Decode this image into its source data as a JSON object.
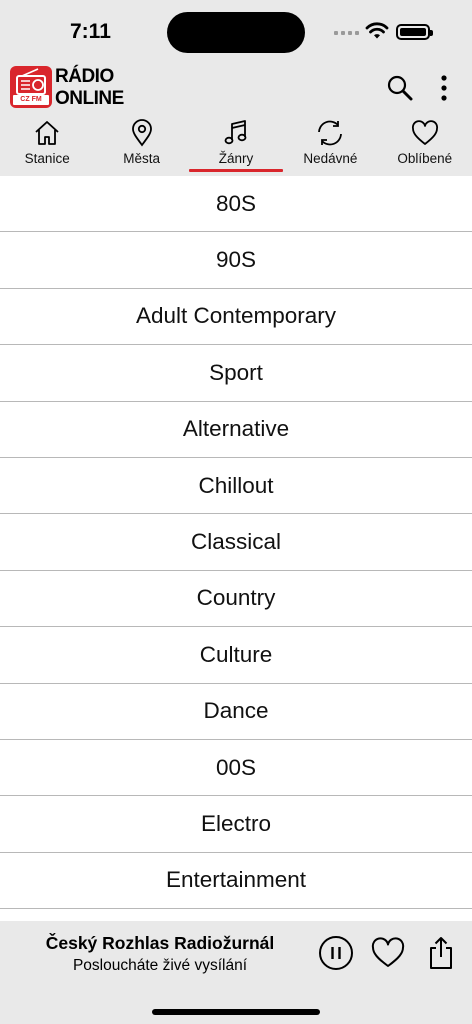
{
  "status_bar": {
    "time": "7:11"
  },
  "header": {
    "logo_text_line1": "RÁDIO",
    "logo_text_line2": "ONLINE",
    "logo_badge": "CZ FM",
    "brand_color": "#d9262c",
    "icons": [
      "search-icon",
      "more-vertical-icon"
    ]
  },
  "tabs": [
    {
      "label": "Stanice",
      "icon": "home-icon"
    },
    {
      "label": "Města",
      "icon": "location-pin-icon"
    },
    {
      "label": "Žánry",
      "icon": "music-note-icon",
      "active": true
    },
    {
      "label": "Nedávné",
      "icon": "refresh-icon"
    },
    {
      "label": "Oblíbené",
      "icon": "heart-icon"
    }
  ],
  "genres": [
    "80S",
    "90S",
    "Adult Contemporary",
    "Sport",
    "Alternative",
    "Chillout",
    "Classical",
    "Country",
    "Culture",
    "Dance",
    "00S",
    "Electro",
    "Entertainment"
  ],
  "player": {
    "station": "Český Rozhlas Radiožurnál",
    "status": "Posloucháte živé vysílání",
    "icons": [
      "pause-icon",
      "heart-icon",
      "share-icon"
    ]
  }
}
